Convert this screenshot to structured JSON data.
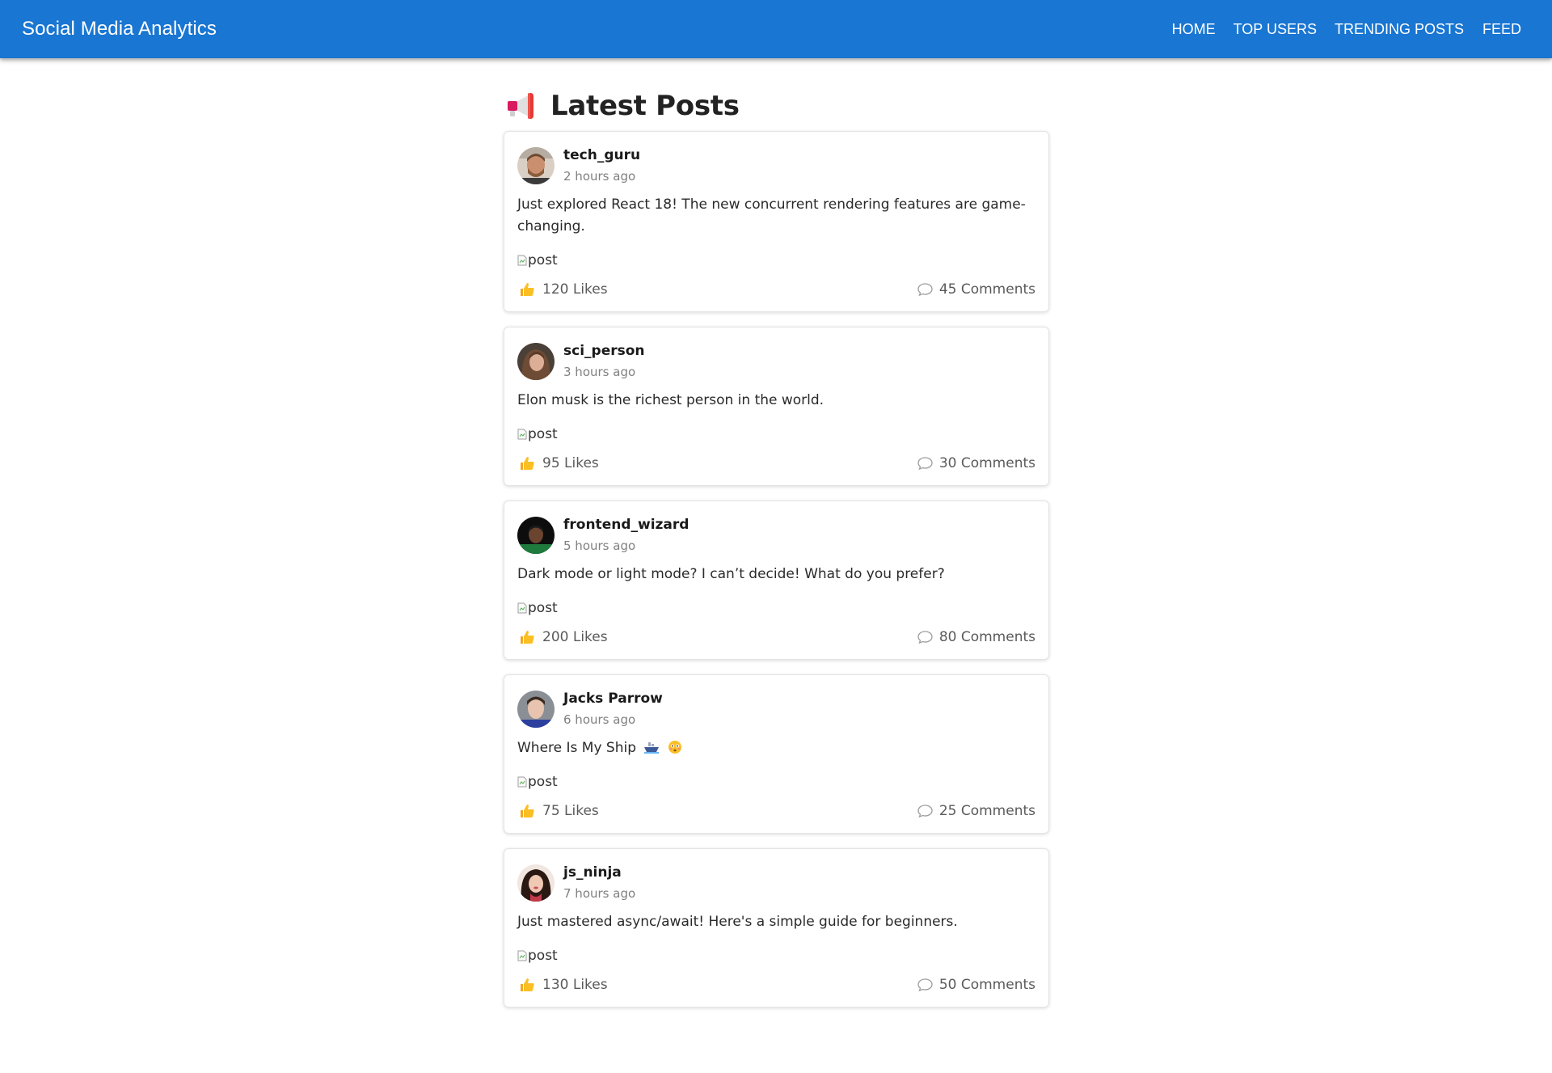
{
  "app": {
    "title": "Social Media Analytics",
    "accent_color": "#1976d2"
  },
  "nav": {
    "items": [
      {
        "label": "HOME"
      },
      {
        "label": "TOP USERS"
      },
      {
        "label": "TRENDING POSTS"
      },
      {
        "label": "FEED"
      }
    ]
  },
  "page": {
    "heading_icon": "megaphone-icon",
    "heading": "Latest Posts"
  },
  "posts": [
    {
      "username": "tech_guru",
      "time": "2 hours ago",
      "content": "Just explored React 18! The new concurrent rendering features are game-changing.",
      "image_alt": "post",
      "likes": "120 Likes",
      "comments": "45 Comments"
    },
    {
      "username": "sci_person",
      "time": "3 hours ago",
      "content": "Elon musk is the richest person in the world.",
      "image_alt": "post",
      "likes": "95 Likes",
      "comments": "30 Comments"
    },
    {
      "username": "frontend_wizard",
      "time": "5 hours ago",
      "content": "Dark mode or light mode? I can’t decide! What do you prefer?",
      "image_alt": "post",
      "likes": "200 Likes",
      "comments": "80 Comments"
    },
    {
      "username": "Jacks Parrow",
      "time": "6 hours ago",
      "content": "Where Is My Ship",
      "content_emojis": [
        "ship-emoji",
        "flushed-face-emoji"
      ],
      "image_alt": "post",
      "likes": "75 Likes",
      "comments": "25 Comments"
    },
    {
      "username": "js_ninja",
      "time": "7 hours ago",
      "content": "Just mastered async/await! Here's a simple guide for beginners.",
      "image_alt": "post",
      "likes": "130 Likes",
      "comments": "50 Comments"
    }
  ]
}
